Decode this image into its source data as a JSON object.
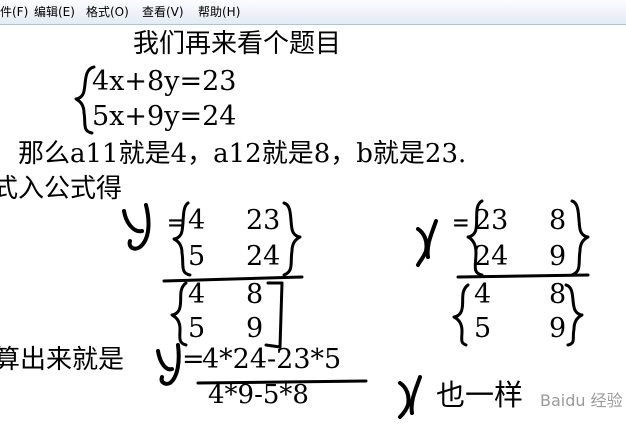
{
  "menu": {
    "file": "件(F)",
    "edit": "编辑(E)",
    "format": "格式(O)",
    "view": "查看(V)",
    "help": "帮助(H)"
  },
  "document": {
    "title": "我们再来看个题目",
    "equation_1": "4x+8y=23",
    "equation_2": "5x+9y=24",
    "coefficients_line": "那么a11就是4，a12就是8，b就是23.",
    "substitute_line": "式入公式得",
    "y_numerator": {
      "r1c1": "4",
      "r1c2": "23",
      "r2c1": "5",
      "r2c2": "24"
    },
    "y_denominator": {
      "r1c1": "4",
      "r1c2": "8",
      "r2c1": "5",
      "r2c2": "9"
    },
    "x_numerator": {
      "r1c1": "23",
      "r1c2": "8",
      "r2c1": "24",
      "r2c2": "9"
    },
    "x_denominator": {
      "r1c1": "4",
      "r1c2": "8",
      "r2c1": "5",
      "r2c2": "9"
    },
    "result_label": "算出来就是",
    "result_equals": "=",
    "result_numerator": "4*24-23*5",
    "result_denominator": "4*9-5*8",
    "x_same": "也一样",
    "handwritten_y": "y",
    "handwritten_x": "x",
    "equals_sign": "=",
    "watermark": "Baidu 经验"
  }
}
